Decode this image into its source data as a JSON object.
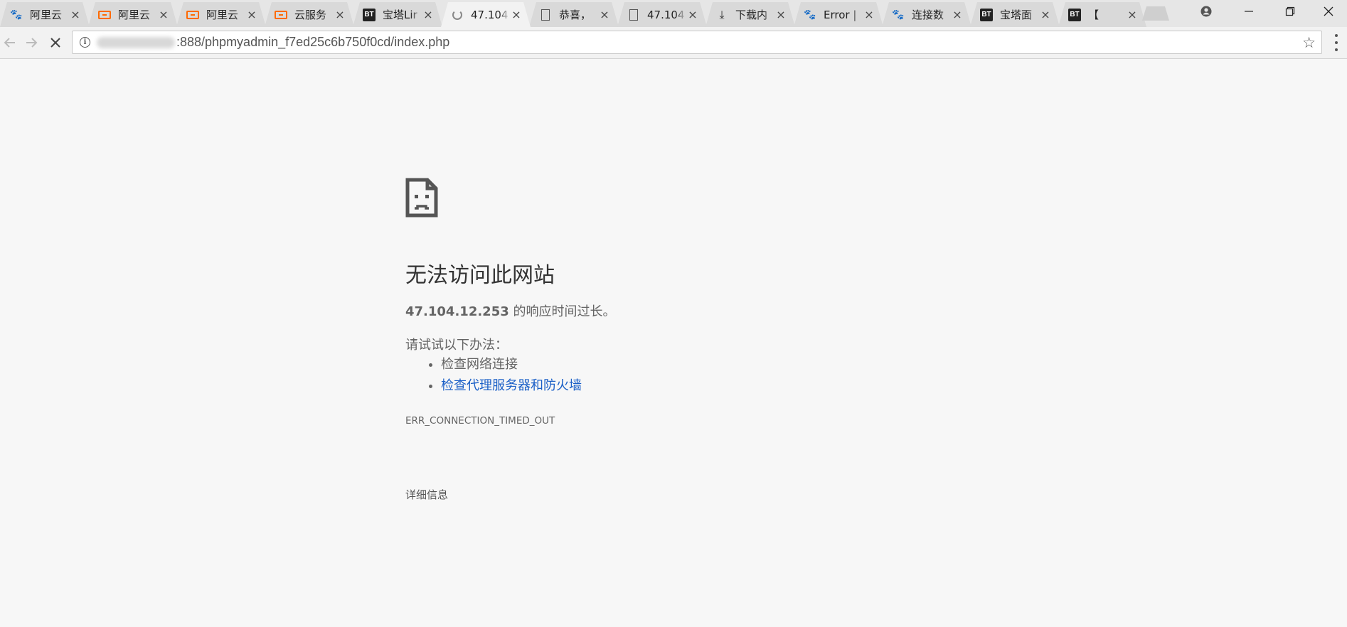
{
  "browser": {
    "tabs": [
      {
        "title": "阿里云",
        "icon": "baidu-paw-icon"
      },
      {
        "title": "阿里云",
        "icon": "aliyun-icon"
      },
      {
        "title": "阿里云",
        "icon": "aliyun-icon"
      },
      {
        "title": "云服务",
        "icon": "aliyun-icon"
      },
      {
        "title": "宝塔Lir",
        "icon": "bt-icon"
      },
      {
        "title": "47.104",
        "icon": "loading-spinner-icon",
        "active": true
      },
      {
        "title": "恭喜，",
        "icon": "document-icon"
      },
      {
        "title": "47.104",
        "icon": "document-icon"
      },
      {
        "title": "下载内",
        "icon": "download-icon"
      },
      {
        "title": "Error |",
        "icon": "baidu-paw-icon"
      },
      {
        "title": "连接数",
        "icon": "baidu-paw-icon"
      },
      {
        "title": "宝塔面",
        "icon": "bt-icon"
      },
      {
        "title": "【",
        "icon": "bt-icon"
      }
    ],
    "bt_label": "BT",
    "close_glyph": "×",
    "url": ":888/phpmyadmin_f7ed25c6b750f0cd/index.php"
  },
  "error_page": {
    "heading": "无法访问此网站",
    "host": "47.104.12.253",
    "summary_suffix": " 的响应时间过长。",
    "try_label": "请试试以下办法：",
    "suggestions": {
      "check_network": "检查网络连接",
      "check_proxy": "检查代理服务器和防火墙"
    },
    "error_code": "ERR_CONNECTION_TIMED_OUT",
    "details_label": "详细信息"
  }
}
